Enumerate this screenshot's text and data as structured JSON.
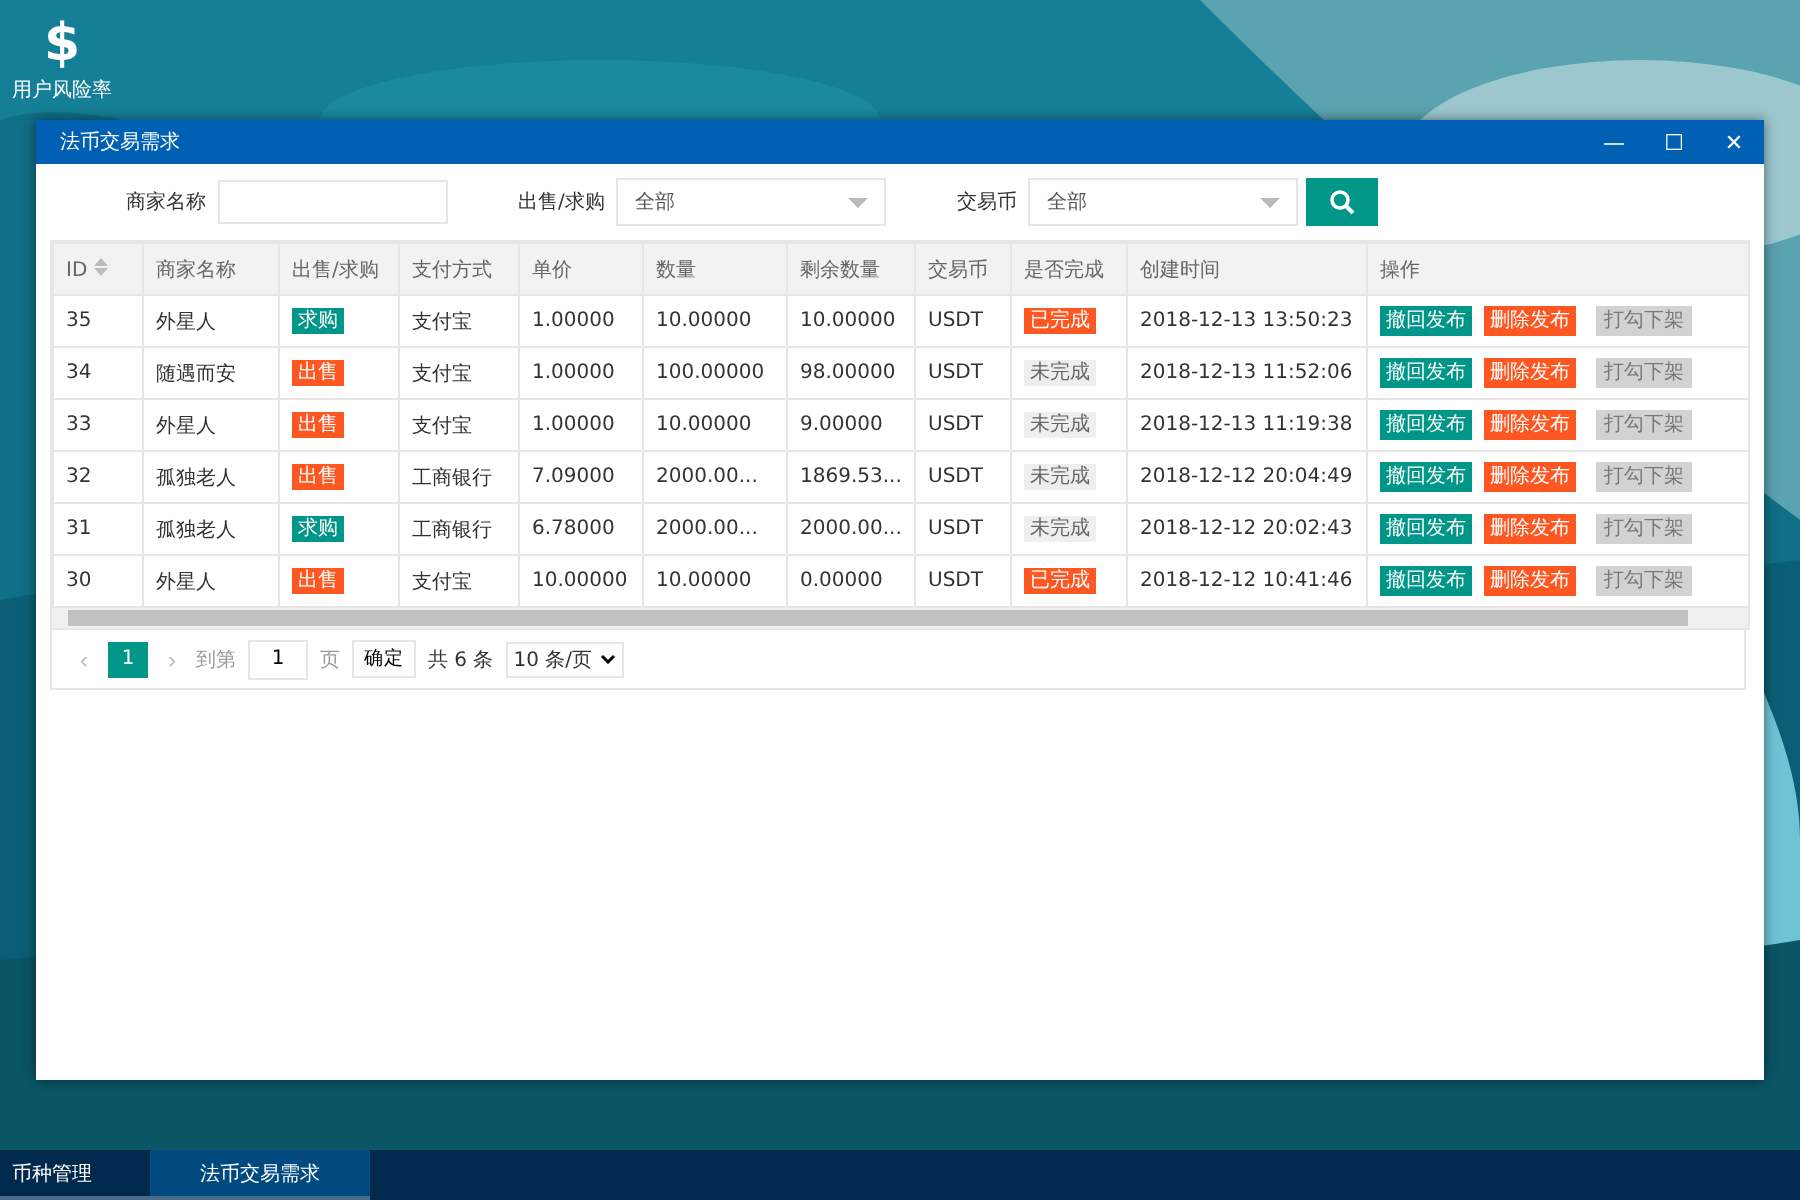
{
  "desktop_icons": [
    {
      "label": "用户风险率",
      "glyph": "$"
    }
  ],
  "window": {
    "title": "法币交易需求",
    "controls": [
      "—",
      "☐",
      "✕"
    ]
  },
  "filters": {
    "merchant": {
      "label": "商家名称"
    },
    "side": {
      "label": "出售/求购",
      "value": "全部"
    },
    "coin": {
      "label": "交易币",
      "value": "全部"
    }
  },
  "table": {
    "columns": [
      "ID",
      "商家名称",
      "出售/求购",
      "支付方式",
      "单价",
      "数量",
      "剩余数量",
      "交易币",
      "是否完成",
      "创建时间",
      "操作"
    ],
    "rows": [
      {
        "id": "35",
        "merchant": "外星人",
        "side": {
          "label": "求购",
          "kind": "buy"
        },
        "pay": "支付宝",
        "price": "1.00000",
        "qty": "10.00000",
        "remaining": "10.00000",
        "coin": "USDT",
        "status": {
          "label": "已完成",
          "done": true
        },
        "time": "2018-12-13 13:50:23",
        "actions": [
          {
            "label": "撤回发布",
            "kind": "withdraw"
          },
          {
            "label": "删除发布",
            "kind": "delete"
          },
          {
            "label": "打勾下架",
            "kind": "disabled"
          }
        ]
      },
      {
        "id": "34",
        "merchant": "随遇而安",
        "side": {
          "label": "出售",
          "kind": "sell"
        },
        "pay": "支付宝",
        "price": "1.00000",
        "qty": "100.00000",
        "remaining": "98.00000",
        "coin": "USDT",
        "status": {
          "label": "未完成",
          "done": false
        },
        "time": "2018-12-13 11:52:06",
        "actions": [
          {
            "label": "撤回发布",
            "kind": "withdraw"
          },
          {
            "label": "删除发布",
            "kind": "delete"
          },
          {
            "label": "打勾下架",
            "kind": "disabled"
          }
        ]
      },
      {
        "id": "33",
        "merchant": "外星人",
        "side": {
          "label": "出售",
          "kind": "sell"
        },
        "pay": "支付宝",
        "price": "1.00000",
        "qty": "10.00000",
        "remaining": "9.00000",
        "coin": "USDT",
        "status": {
          "label": "未完成",
          "done": false
        },
        "time": "2018-12-13 11:19:38",
        "actions": [
          {
            "label": "撤回发布",
            "kind": "withdraw"
          },
          {
            "label": "删除发布",
            "kind": "delete"
          },
          {
            "label": "打勾下架",
            "kind": "disabled"
          }
        ]
      },
      {
        "id": "32",
        "merchant": "孤独老人",
        "side": {
          "label": "出售",
          "kind": "sell"
        },
        "pay": "工商银行",
        "price": "7.09000",
        "qty": "2000.00...",
        "remaining": "1869.53...",
        "coin": "USDT",
        "status": {
          "label": "未完成",
          "done": false
        },
        "time": "2018-12-12 20:04:49",
        "actions": [
          {
            "label": "撤回发布",
            "kind": "withdraw"
          },
          {
            "label": "删除发布",
            "kind": "delete"
          },
          {
            "label": "打勾下架",
            "kind": "disabled"
          }
        ]
      },
      {
        "id": "31",
        "merchant": "孤独老人",
        "side": {
          "label": "求购",
          "kind": "buy"
        },
        "pay": "工商银行",
        "price": "6.78000",
        "qty": "2000.00...",
        "remaining": "2000.00...",
        "coin": "USDT",
        "status": {
          "label": "未完成",
          "done": false
        },
        "time": "2018-12-12 20:02:43",
        "actions": [
          {
            "label": "撤回发布",
            "kind": "withdraw"
          },
          {
            "label": "删除发布",
            "kind": "delete"
          },
          {
            "label": "打勾下架",
            "kind": "disabled"
          }
        ]
      },
      {
        "id": "30",
        "merchant": "外星人",
        "side": {
          "label": "出售",
          "kind": "sell"
        },
        "pay": "支付宝",
        "price": "10.00000",
        "qty": "10.00000",
        "remaining": "0.00000",
        "coin": "USDT",
        "status": {
          "label": "已完成",
          "done": true
        },
        "time": "2018-12-12 10:41:46",
        "actions": [
          {
            "label": "撤回发布",
            "kind": "withdraw"
          },
          {
            "label": "删除发布",
            "kind": "delete"
          },
          {
            "label": "打勾下架",
            "kind": "disabled"
          }
        ]
      }
    ]
  },
  "pagination": {
    "prev": "‹",
    "pages": [
      {
        "label": "1",
        "selected": true
      }
    ],
    "next": "›",
    "goto_label": "到第",
    "page_input": "1",
    "page_suffix": "页",
    "confirm": "确定",
    "total": "共 6 条",
    "page_size": "10 条/页"
  },
  "taskbar": [
    {
      "label": "币种管理",
      "selected": false
    },
    {
      "label": "法币交易需求",
      "selected": true
    }
  ]
}
